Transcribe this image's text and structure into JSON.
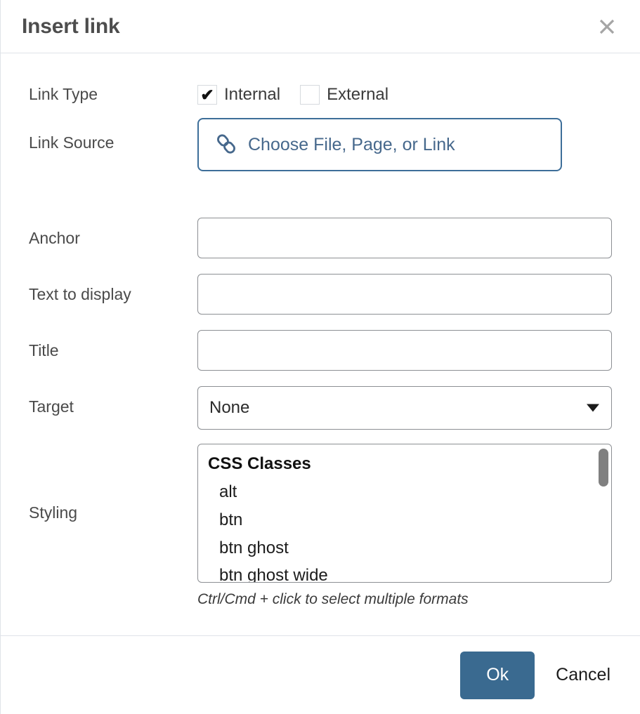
{
  "dialog": {
    "title": "Insert link",
    "close_icon": "close-icon"
  },
  "form": {
    "link_type": {
      "label": "Link Type",
      "options": [
        {
          "label": "Internal",
          "checked": true
        },
        {
          "label": "External",
          "checked": false
        }
      ]
    },
    "link_source": {
      "label": "Link Source",
      "button_label": "Choose File, Page, or Link",
      "icon": "chain-link-icon"
    },
    "anchor": {
      "label": "Anchor",
      "value": "",
      "placeholder": ""
    },
    "text_to_display": {
      "label": "Text to display",
      "value": "",
      "placeholder": ""
    },
    "title_field": {
      "label": "Title",
      "value": "",
      "placeholder": ""
    },
    "target": {
      "label": "Target",
      "value": "None",
      "chevron_icon": "chevron-down-icon"
    },
    "styling": {
      "label": "Styling",
      "group_label": "CSS Classes",
      "options": [
        "alt",
        "btn",
        "btn ghost",
        "btn ghost wide"
      ],
      "helper_text": "Ctrl/Cmd + click to select multiple formats"
    }
  },
  "footer": {
    "ok_label": "Ok",
    "cancel_label": "Cancel"
  },
  "colors": {
    "accent_blue": "#3a6a90",
    "link_border_blue": "#3d6e99",
    "link_text_blue": "#46688c",
    "divider": "#dfe3e8",
    "label_gray": "#4a4a4a"
  }
}
